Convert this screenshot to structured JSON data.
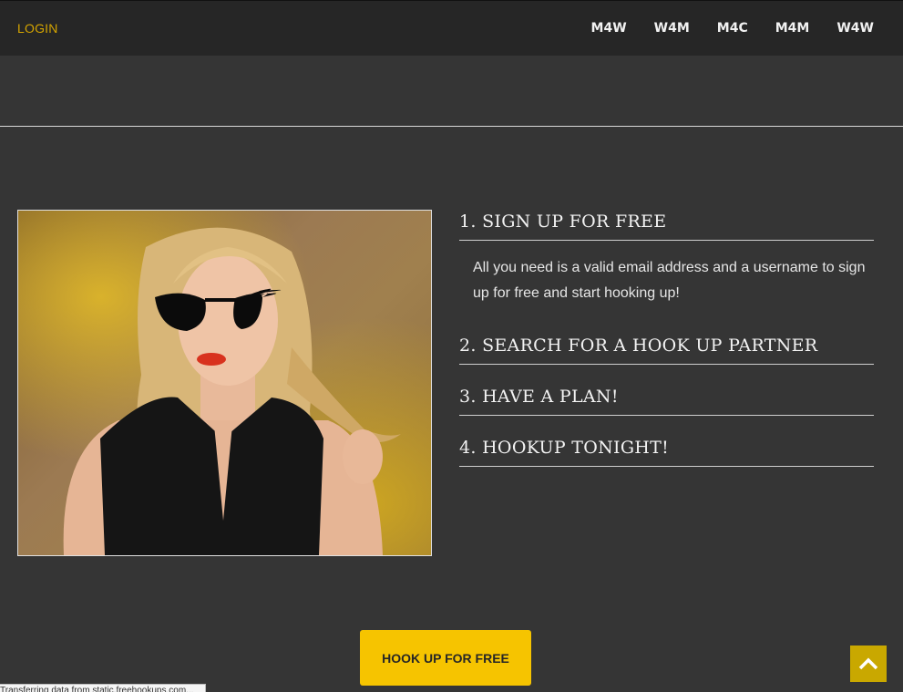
{
  "header": {
    "login_label": "LOGIN",
    "nav": [
      "M4W",
      "W4M",
      "M4C",
      "M4M",
      "W4W"
    ],
    "accent_color": "#d4a400"
  },
  "hero_image": {
    "description_icon": "woman-sunglasses-photo"
  },
  "steps": [
    {
      "title": "1. SIGN UP FOR FREE",
      "description": "All you need is a valid email address and a username to sign up for free and start hooking up!"
    },
    {
      "title": "2. SEARCH FOR A HOOK UP PARTNER"
    },
    {
      "title": "3. HAVE A PLAN!"
    },
    {
      "title": "4. HOOKUP TONIGHT!"
    }
  ],
  "cta": {
    "label": "HOOK UP FOR FREE",
    "color": "#f6c400"
  },
  "scroll_top": {
    "icon": "chevron-up-icon",
    "color": "#c9a800"
  },
  "status_bar": {
    "text": "Transferring data from static.freehookups.com..."
  }
}
